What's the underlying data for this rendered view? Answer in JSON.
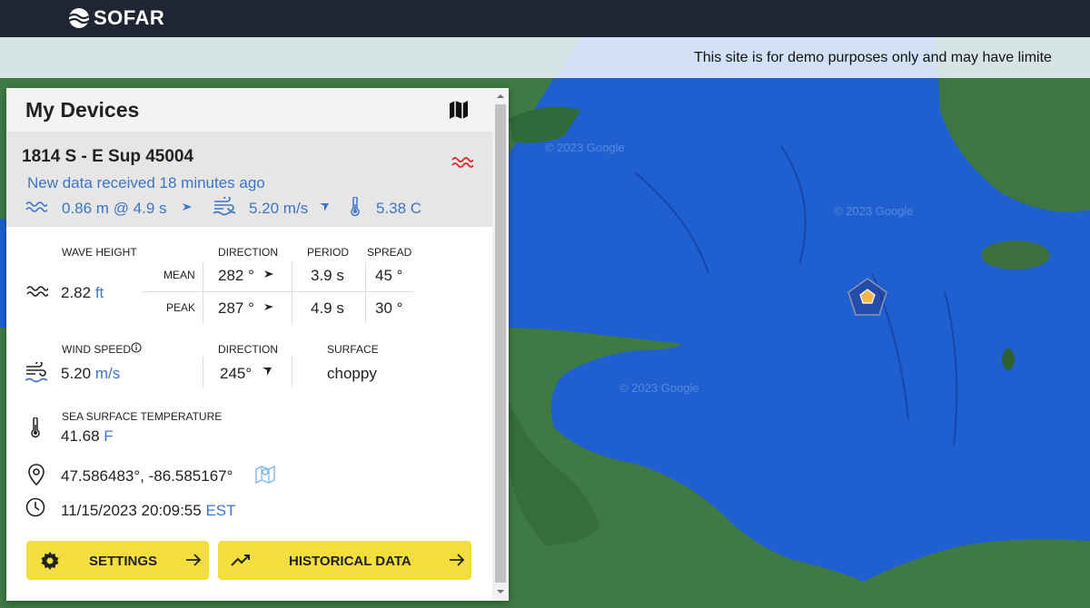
{
  "header": {
    "brand": "SOFAR"
  },
  "banner": {
    "text": "This site is for demo purposes only and may have limite"
  },
  "map": {
    "watermark": "© 2023 Google",
    "water_color": "#1f5fd0",
    "land_color": "#3f7a44"
  },
  "panel": {
    "title": "My Devices",
    "device": {
      "name": "1814 S - E Sup 45004",
      "new_data": "New data received 18 minutes ago",
      "summary": {
        "wave": "0.86 m @ 4.9 s",
        "wind": "5.20 m/s",
        "temp": "5.38 C"
      }
    },
    "wave": {
      "label": "WAVE HEIGHT",
      "value": "2.82",
      "unit": "ft",
      "headers": {
        "direction": "DIRECTION",
        "period": "PERIOD",
        "spread": "SPREAD"
      },
      "mean": {
        "label": "MEAN",
        "direction": "282 °",
        "period": "3.9 s",
        "spread": "45 °"
      },
      "peak": {
        "label": "PEAK",
        "direction": "287 °",
        "period": "4.9 s",
        "spread": "30 °"
      }
    },
    "wind": {
      "label": "WIND SPEED",
      "value": "5.20",
      "unit": "m/s",
      "direction_label": "DIRECTION",
      "direction": "245°",
      "surface_label": "SURFACE",
      "surface": "choppy"
    },
    "sst": {
      "label": "SEA SURFACE TEMPERATURE",
      "value": "41.68",
      "unit": "F"
    },
    "location": {
      "coords": "47.586483°, -86.585167°"
    },
    "time": {
      "value": "11/15/2023 20:09:55",
      "tz": "EST"
    },
    "buttons": {
      "settings": "SETTINGS",
      "historical": "HISTORICAL DATA"
    }
  },
  "colors": {
    "accent_blue": "#3d74c6",
    "button_yellow": "#f2de3c",
    "topbar": "#1f2533",
    "alert_red": "#e0242a"
  }
}
